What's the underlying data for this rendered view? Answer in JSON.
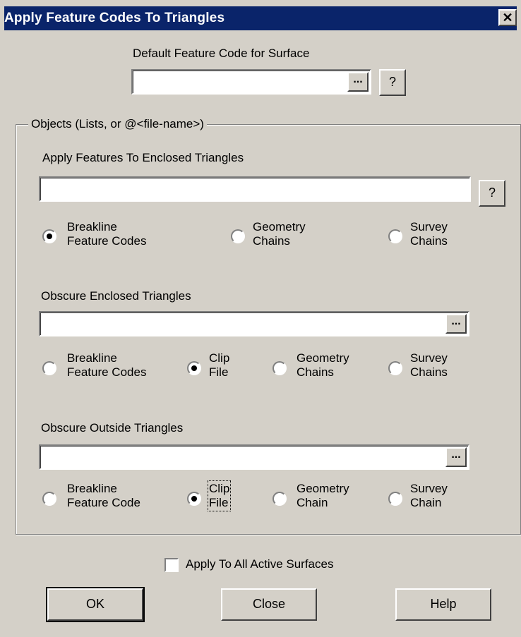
{
  "window": {
    "title": "Apply Feature Codes To Triangles",
    "close_glyph": "✕"
  },
  "default_section": {
    "label": "Default Feature Code for Surface",
    "value": "",
    "browse_label": "...",
    "help_label": "?"
  },
  "objects_group": {
    "legend": "Objects (Lists, or @<file-name>)",
    "enclosed_features": {
      "label": "Apply Features To Enclosed Triangles",
      "value": "",
      "help_label": "?",
      "options": [
        {
          "line1": "Breakline",
          "line2": "Feature Codes",
          "selected": true
        },
        {
          "line1": "Geometry",
          "line2": "Chains",
          "selected": false
        },
        {
          "line1": "Survey",
          "line2": "Chains",
          "selected": false
        }
      ]
    },
    "obscure_enclosed": {
      "label": "Obscure Enclosed Triangles",
      "value": "",
      "browse_label": "...",
      "options": [
        {
          "line1": "Breakline",
          "line2": "Feature Codes",
          "selected": false
        },
        {
          "line1": "Clip",
          "line2": "File",
          "selected": true
        },
        {
          "line1": "Geometry",
          "line2": "Chains",
          "selected": false
        },
        {
          "line1": "Survey",
          "line2": "Chains",
          "selected": false
        }
      ]
    },
    "obscure_outside": {
      "label": "Obscure Outside Triangles",
      "value": "",
      "browse_label": "...",
      "options": [
        {
          "line1": "Breakline",
          "line2": "Feature Code",
          "selected": false
        },
        {
          "line1": "Clip",
          "line2": "File",
          "selected": true
        },
        {
          "line1": "Geometry",
          "line2": "Chain",
          "selected": false
        },
        {
          "line1": "Survey",
          "line2": "Chain",
          "selected": false
        }
      ]
    }
  },
  "apply_all": {
    "label": "Apply To All Active Surfaces",
    "checked": false
  },
  "buttons": {
    "ok": "OK",
    "close": "Close",
    "help": "Help"
  }
}
